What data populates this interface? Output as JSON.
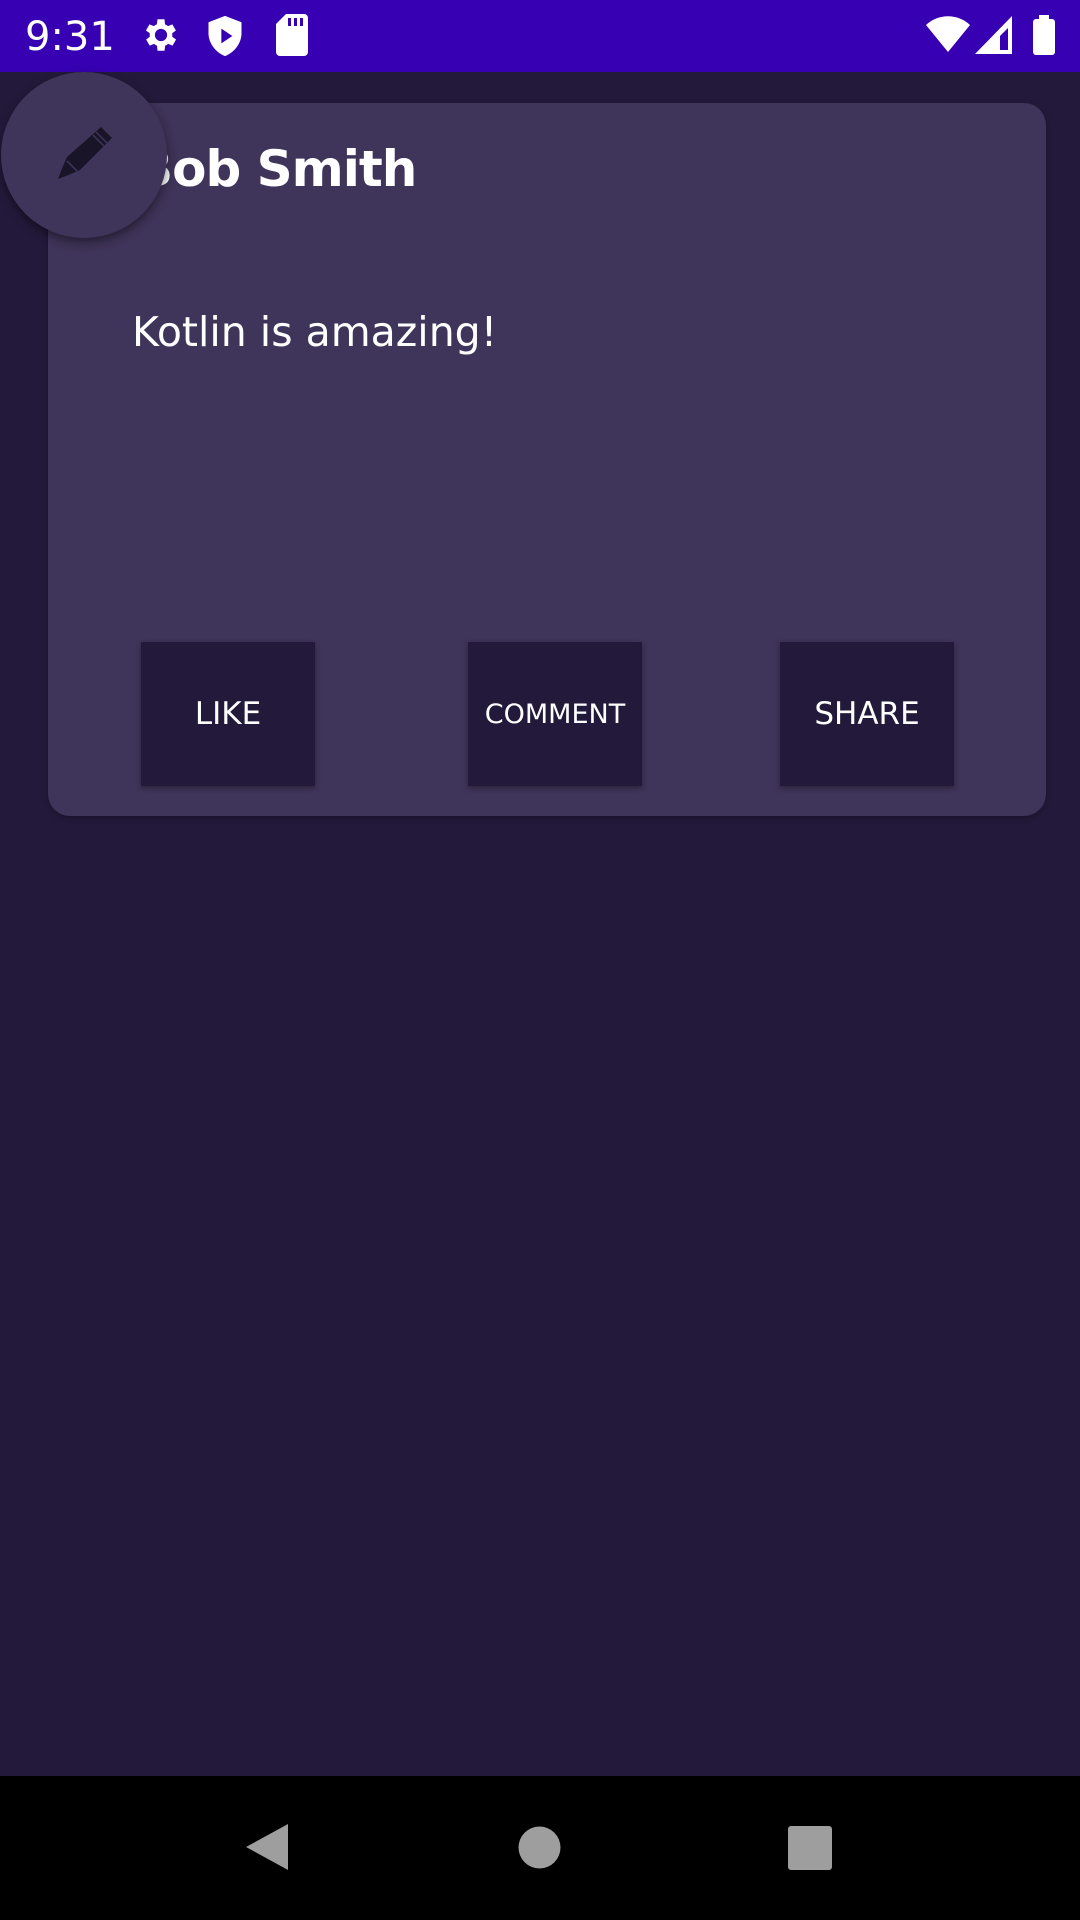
{
  "status_bar": {
    "time": "9:31",
    "icons": [
      "gear-icon",
      "play-protect-icon",
      "sd-card-icon",
      "wifi-icon",
      "cell-signal-icon",
      "battery-icon"
    ],
    "color": "#3700b3"
  },
  "post": {
    "author": "Bob Smith",
    "content": "Kotlin is amazing!"
  },
  "actions": {
    "like": "LIKE",
    "comment": "COMMENT",
    "share": "SHARE"
  },
  "fab": {
    "icon": "pencil-icon"
  },
  "nav_bar": {
    "icons": [
      "back-icon",
      "home-icon",
      "recents-icon"
    ]
  },
  "colors": {
    "background": "#231a3b",
    "card": "#3f3459"
  }
}
